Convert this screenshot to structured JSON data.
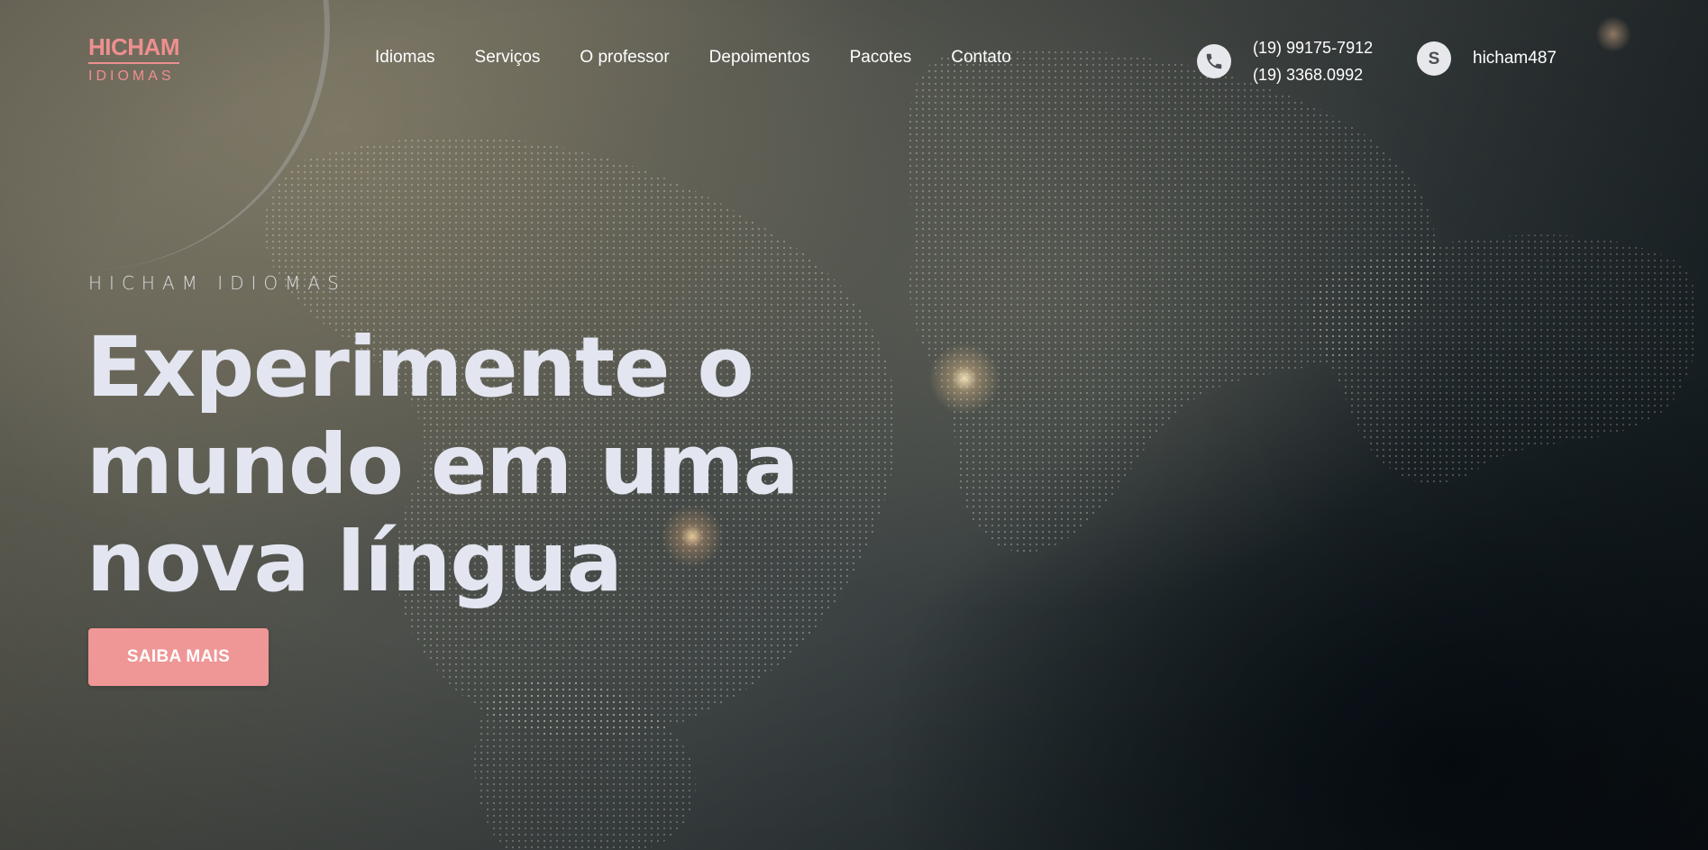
{
  "header": {
    "logo": {
      "main": "HICHAM",
      "sub": "IDIOMAS"
    },
    "nav": [
      {
        "label": "Idiomas"
      },
      {
        "label": "Serviços"
      },
      {
        "label": "O professor"
      },
      {
        "label": "Depoimentos"
      },
      {
        "label": "Pacotes"
      },
      {
        "label": "Contato"
      }
    ],
    "contact": {
      "phone_icon": "phone-icon",
      "phones": [
        "(19) 99175-7912",
        "(19) 3368.0992"
      ],
      "skype_icon": "skype-icon",
      "skype": "hicham487"
    }
  },
  "hero": {
    "eyebrow": "HICHAM IDIOMAS",
    "headline": [
      "Experimente o",
      "mundo em uma",
      "nova língua"
    ],
    "cta_label": "SAIBA MAIS",
    "background": "world-map-space-background"
  },
  "colors": {
    "accent": "#ef9696",
    "headline": "#e3e6f0",
    "icon_bg": "#e6e8ec"
  }
}
